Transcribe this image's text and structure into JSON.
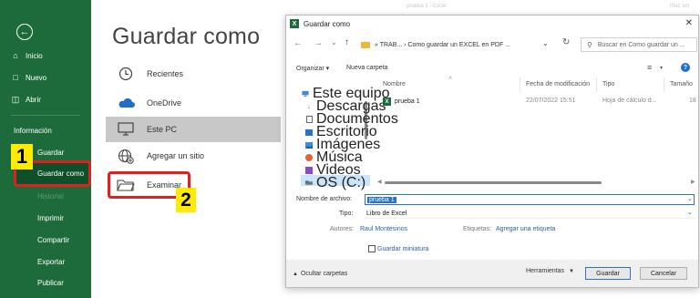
{
  "leftnav": {
    "back_icon": "back-arrow-icon",
    "items": [
      {
        "label": "Inicio",
        "icon": "home-icon"
      },
      {
        "label": "Nuevo",
        "icon": "new-document-icon"
      },
      {
        "label": "Abrir",
        "icon": "open-folder-icon"
      }
    ],
    "text_items": [
      {
        "label": "Información",
        "dim": false
      },
      {
        "label": "Guardar",
        "dim": false
      },
      {
        "label": "Guardar como",
        "dim": false
      },
      {
        "label": "Historial",
        "dim": true
      },
      {
        "label": "Imprimir",
        "dim": false
      },
      {
        "label": "Compartir",
        "dim": false
      },
      {
        "label": "Exportar",
        "dim": false
      },
      {
        "label": "Publicar",
        "dim": false
      }
    ]
  },
  "badges": {
    "one": "1",
    "two": "2"
  },
  "middle": {
    "title": "Guardar como",
    "locations": [
      {
        "label": "Recientes",
        "icon": "clock-icon"
      },
      {
        "label": "OneDrive",
        "icon": "onedrive-cloud-icon"
      },
      {
        "label": "Este PC",
        "icon": "computer-icon"
      },
      {
        "label": "Agregar un sitio",
        "icon": "globe-plus-icon"
      },
      {
        "label": "Examinar",
        "icon": "folder-icon"
      }
    ]
  },
  "background_title": {
    "center": "prueba 1  -  Excel",
    "right": "Iñuc sm"
  },
  "dialog": {
    "title": "Guardar como",
    "address": {
      "segments": "« TRAB...  ›  Como guardar un EXCEL en PDF ...",
      "search_placeholder": "Buscar en Como guardar un ..."
    },
    "toolbar": {
      "organize": "Organizar ▾",
      "new_folder": "Nueva carpeta"
    },
    "tree": [
      {
        "label": "Este equipo",
        "icon": "computer-icon"
      },
      {
        "label": "Descargas",
        "icon": "download-arrow-icon"
      },
      {
        "label": "Documentos",
        "icon": "documents-icon"
      },
      {
        "label": "Escritorio",
        "icon": "desktop-icon"
      },
      {
        "label": "Imágenes",
        "icon": "images-icon"
      },
      {
        "label": "Música",
        "icon": "music-icon"
      },
      {
        "label": "Videos",
        "icon": "videos-icon"
      },
      {
        "label": "OS (C:)",
        "icon": "drive-icon"
      }
    ],
    "columns": {
      "name": "Nombre",
      "modified": "Fecha de modificación",
      "type": "Tipo",
      "size": "Tamaño"
    },
    "files": [
      {
        "name": "prueba 1",
        "modified": "22/07/2022 15:51",
        "type": "Hoja de cálculo d...",
        "size": "18"
      }
    ],
    "fields": {
      "filename_label": "Nombre de archivo:",
      "filename_value": "prueba 1",
      "type_label": "Tipo:",
      "type_value": "Libro de Excel",
      "authors_label": "Autores:",
      "authors_value": "Raul Montesinos",
      "tags_label": "Etiquetas:",
      "tags_value": "Agregar una etiqueta",
      "thumbnail_label": "Guardar miniatura"
    },
    "footer": {
      "hide_folders": "Ocultar carpetas",
      "tools": "Herramientas",
      "save": "Guardar",
      "cancel": "Cancelar"
    }
  }
}
